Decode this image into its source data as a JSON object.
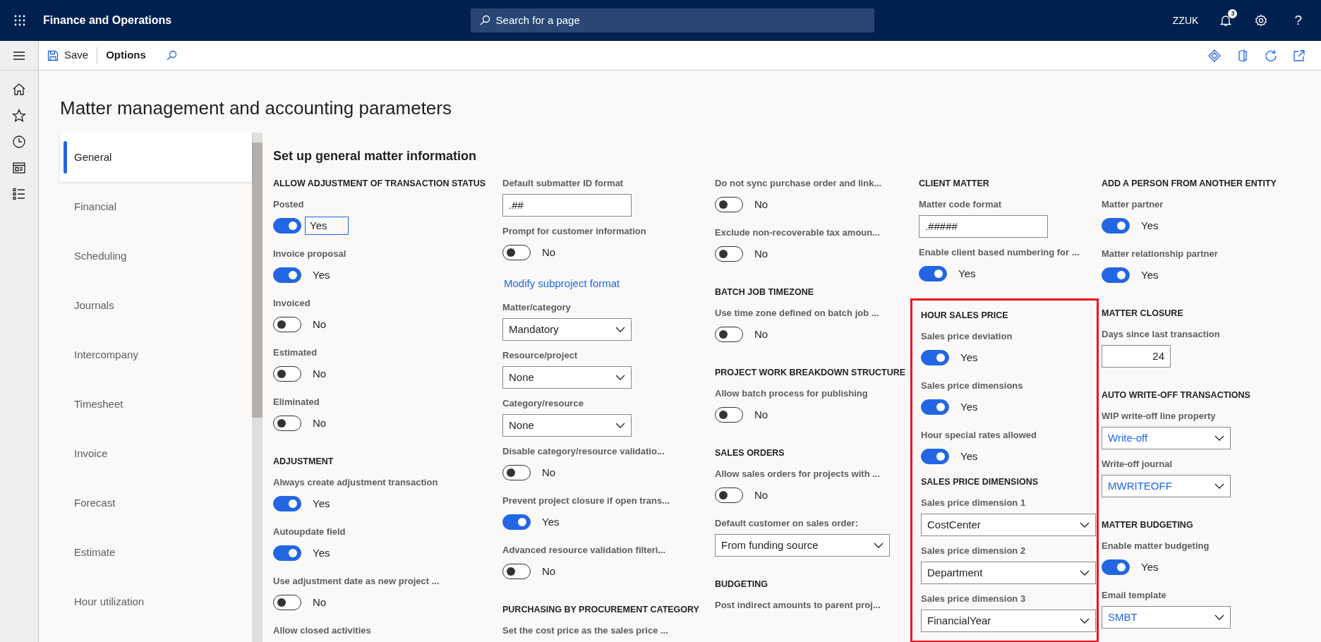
{
  "app": {
    "title": "Finance and Operations",
    "search_placeholder": "Search for a page",
    "company": "ZZUK",
    "notification_count": "3",
    "help_glyph": "?"
  },
  "toolbar": {
    "save": "Save",
    "options": "Options"
  },
  "page_title": "Matter management and accounting parameters",
  "tabs": [
    {
      "label": "General",
      "selected": true
    },
    {
      "label": "Financial",
      "selected": false
    },
    {
      "label": "Scheduling",
      "selected": false
    },
    {
      "label": "Journals",
      "selected": false
    },
    {
      "label": "Intercompany",
      "selected": false
    },
    {
      "label": "Timesheet",
      "selected": false
    },
    {
      "label": "Invoice",
      "selected": false
    },
    {
      "label": "Forecast",
      "selected": false
    },
    {
      "label": "Estimate",
      "selected": false
    },
    {
      "label": "Hour utilization",
      "selected": false
    }
  ],
  "section_title": "Set up general matter information",
  "columns": [
    {
      "sections": [
        {
          "heading": "ALLOW ADJUSTMENT OF TRANSACTION STATUS",
          "highlighted": false,
          "items": [
            {
              "kind": "toggle",
              "label": "Posted",
              "on": true,
              "value": "Yes",
              "focused": true
            },
            {
              "kind": "toggle",
              "label": "Invoice proposal",
              "on": true,
              "value": "Yes",
              "focused": false
            },
            {
              "kind": "toggle",
              "label": "Invoiced",
              "on": false,
              "value": "No",
              "focused": false
            },
            {
              "kind": "toggle",
              "label": "Estimated",
              "on": false,
              "value": "No",
              "focused": false
            },
            {
              "kind": "toggle",
              "label": "Eliminated",
              "on": false,
              "value": "No",
              "focused": false
            }
          ]
        },
        {
          "heading": "ADJUSTMENT",
          "highlighted": false,
          "items": [
            {
              "kind": "toggle",
              "label": "Always create adjustment transaction",
              "on": true,
              "value": "Yes",
              "focused": false
            },
            {
              "kind": "toggle",
              "label": "Autoupdate field",
              "on": true,
              "value": "Yes",
              "focused": false
            },
            {
              "kind": "toggle",
              "label": "Use adjustment date as new project ...",
              "on": false,
              "value": "No",
              "focused": false
            },
            {
              "kind": "label",
              "label": "Allow closed activities"
            }
          ]
        }
      ]
    },
    {
      "sections": [
        {
          "highlighted": false,
          "items": [
            {
              "kind": "text-field",
              "label": "Default submatter ID format",
              "value": ".##"
            },
            {
              "kind": "toggle",
              "label": "Prompt for customer information",
              "on": false,
              "value": "No",
              "focused": false
            },
            {
              "kind": "link",
              "label": "Modify subproject format"
            },
            {
              "kind": "dropdown",
              "label": "Matter/category",
              "value": "Mandatory",
              "linked": false
            },
            {
              "kind": "dropdown",
              "label": "Resource/project",
              "value": "None",
              "linked": false
            },
            {
              "kind": "dropdown",
              "label": "Category/resource",
              "value": "None",
              "linked": false
            },
            {
              "kind": "toggle",
              "label": "Disable category/resource validatio...",
              "on": false,
              "value": "No",
              "focused": false
            },
            {
              "kind": "toggle",
              "label": "Prevent project closure if open trans...",
              "on": true,
              "value": "Yes",
              "focused": false
            },
            {
              "kind": "toggle",
              "label": "Advanced resource validation filteri...",
              "on": false,
              "value": "No",
              "focused": false
            }
          ]
        },
        {
          "heading": "PURCHASING BY PROCUREMENT CATEGORY",
          "highlighted": false,
          "items": [
            {
              "kind": "label",
              "label": "Set the cost price as the sales price ..."
            }
          ]
        }
      ]
    },
    {
      "sections": [
        {
          "highlighted": false,
          "items": [
            {
              "kind": "toggle",
              "label": "Do not sync purchase order and link...",
              "on": false,
              "value": "No",
              "focused": false
            },
            {
              "kind": "toggle",
              "label": "Exclude non-recoverable tax amoun...",
              "on": false,
              "value": "No",
              "focused": false
            }
          ]
        },
        {
          "heading": "BATCH JOB TIMEZONE",
          "highlighted": false,
          "items": [
            {
              "kind": "toggle",
              "label": "Use time zone defined on batch job ...",
              "on": false,
              "value": "No",
              "focused": false
            }
          ]
        },
        {
          "heading": "PROJECT WORK BREAKDOWN STRUCTURE",
          "highlighted": false,
          "items": [
            {
              "kind": "toggle",
              "label": "Allow batch process for publishing",
              "on": false,
              "value": "No",
              "focused": false
            }
          ]
        },
        {
          "heading": "SALES ORDERS",
          "highlighted": false,
          "items": [
            {
              "kind": "toggle",
              "label": "Allow sales orders for projects with ...",
              "on": false,
              "value": "No",
              "focused": false
            },
            {
              "kind": "dropdown",
              "label": "Default customer on sales order:",
              "value": "From funding source",
              "linked": false
            }
          ]
        },
        {
          "heading": "BUDGETING",
          "highlighted": false,
          "items": [
            {
              "kind": "label",
              "label": "Post indirect amounts to parent proj..."
            }
          ]
        }
      ]
    },
    {
      "sections": [
        {
          "heading": "CLIENT MATTER",
          "highlighted": false,
          "items": [
            {
              "kind": "text-field",
              "label": "Matter code format",
              "value": ".#####"
            },
            {
              "kind": "toggle",
              "label": "Enable client based numbering for ...",
              "on": true,
              "value": "Yes",
              "focused": false
            }
          ]
        },
        {
          "heading": "HOUR SALES PRICE",
          "highlighted": true,
          "items": [
            {
              "kind": "toggle",
              "label": "Sales price deviation",
              "on": true,
              "value": "Yes",
              "focused": false
            },
            {
              "kind": "toggle",
              "label": "Sales price dimensions",
              "on": true,
              "value": "Yes",
              "focused": false
            },
            {
              "kind": "toggle",
              "label": "Hour special rates allowed",
              "on": true,
              "value": "Yes",
              "focused": false
            }
          ],
          "subsection": {
            "heading": "SALES PRICE DIMENSIONS",
            "items": [
              {
                "kind": "dropdown",
                "label": "Sales price dimension 1",
                "value": "CostCenter",
                "linked": false
              },
              {
                "kind": "dropdown",
                "label": "Sales price dimension 2",
                "value": "Department",
                "linked": false
              },
              {
                "kind": "dropdown",
                "label": "Sales price dimension 3",
                "value": "FinancialYear",
                "linked": false
              }
            ]
          }
        }
      ]
    },
    {
      "sections": [
        {
          "heading": "ADD A PERSON FROM ANOTHER ENTITY",
          "highlighted": false,
          "items": [
            {
              "kind": "toggle",
              "label": "Matter partner",
              "on": true,
              "value": "Yes",
              "focused": false
            },
            {
              "kind": "toggle",
              "label": "Matter relationship partner",
              "on": true,
              "value": "Yes",
              "focused": false
            }
          ]
        },
        {
          "heading": "MATTER CLOSURE",
          "highlighted": false,
          "items": [
            {
              "kind": "number-field",
              "label": "Days since last transaction",
              "value": "24"
            }
          ]
        },
        {
          "heading": "AUTO WRITE-OFF TRANSACTIONS",
          "highlighted": false,
          "items": [
            {
              "kind": "dropdown",
              "label": "WIP write-off line property",
              "value": "Write-off",
              "linked": true
            },
            {
              "kind": "dropdown",
              "label": "Write-off journal",
              "value": "MWRITEOFF",
              "linked": true
            }
          ]
        },
        {
          "heading": "MATTER BUDGETING",
          "highlighted": false,
          "items": [
            {
              "kind": "toggle",
              "label": "Enable matter budgeting",
              "on": true,
              "value": "Yes",
              "focused": false
            },
            {
              "kind": "dropdown",
              "label": "Email template",
              "value": "SMBT",
              "linked": true
            }
          ]
        }
      ]
    }
  ]
}
